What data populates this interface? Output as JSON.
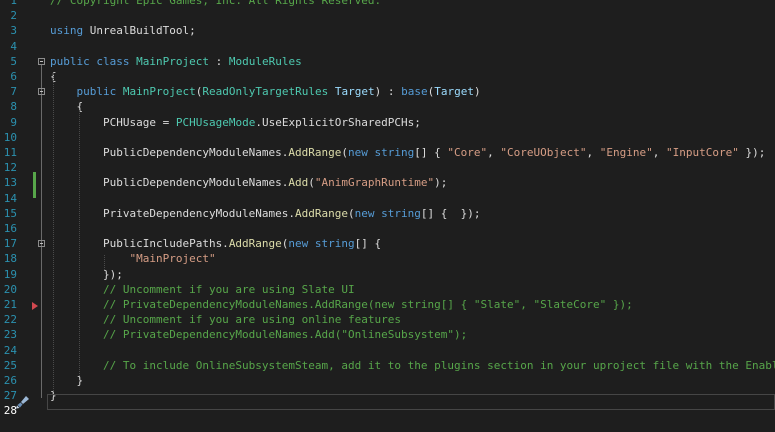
{
  "editor": {
    "language": "C#",
    "current_line": 28,
    "lines": [
      {
        "n": "1",
        "segments": [
          {
            "t": "// Copyright Epic Games, Inc. All Rights Reserved.",
            "c": "comment"
          }
        ]
      },
      {
        "n": "2",
        "segments": []
      },
      {
        "n": "3",
        "segments": [
          {
            "t": "using",
            "c": "keyword"
          },
          {
            "t": " UnrealBuildTool;",
            "c": "plain"
          }
        ]
      },
      {
        "n": "4",
        "segments": []
      },
      {
        "n": "5",
        "segments": [
          {
            "t": "public",
            "c": "keyword"
          },
          {
            "t": " ",
            "c": "plain"
          },
          {
            "t": "class",
            "c": "keyword"
          },
          {
            "t": " ",
            "c": "plain"
          },
          {
            "t": "MainProject",
            "c": "type"
          },
          {
            "t": " : ",
            "c": "plain"
          },
          {
            "t": "ModuleRules",
            "c": "type"
          }
        ]
      },
      {
        "n": "6",
        "segments": [
          {
            "t": "{",
            "c": "plain"
          }
        ]
      },
      {
        "n": "7",
        "segments": [
          {
            "t": "    ",
            "c": "plain"
          },
          {
            "t": "public",
            "c": "keyword"
          },
          {
            "t": " ",
            "c": "plain"
          },
          {
            "t": "MainProject",
            "c": "type"
          },
          {
            "t": "(",
            "c": "plain"
          },
          {
            "t": "ReadOnlyTargetRules",
            "c": "type"
          },
          {
            "t": " ",
            "c": "plain"
          },
          {
            "t": "Target",
            "c": "param"
          },
          {
            "t": ") : ",
            "c": "plain"
          },
          {
            "t": "base",
            "c": "keyword"
          },
          {
            "t": "(",
            "c": "plain"
          },
          {
            "t": "Target",
            "c": "param"
          },
          {
            "t": ")",
            "c": "plain"
          }
        ]
      },
      {
        "n": "8",
        "segments": [
          {
            "t": "    {",
            "c": "plain"
          }
        ]
      },
      {
        "n": "9",
        "segments": [
          {
            "t": "        PCHUsage = ",
            "c": "plain"
          },
          {
            "t": "PCHUsageMode",
            "c": "type"
          },
          {
            "t": ".UseExplicitOrSharedPCHs;",
            "c": "plain"
          }
        ]
      },
      {
        "n": "10",
        "segments": []
      },
      {
        "n": "11",
        "segments": [
          {
            "t": "        PublicDependencyModuleNames.",
            "c": "plain"
          },
          {
            "t": "AddRange",
            "c": "method"
          },
          {
            "t": "(",
            "c": "plain"
          },
          {
            "t": "new",
            "c": "keyword"
          },
          {
            "t": " ",
            "c": "plain"
          },
          {
            "t": "string",
            "c": "keyword"
          },
          {
            "t": "[] { ",
            "c": "plain"
          },
          {
            "t": "\"Core\"",
            "c": "string"
          },
          {
            "t": ", ",
            "c": "plain"
          },
          {
            "t": "\"CoreUObject\"",
            "c": "string"
          },
          {
            "t": ", ",
            "c": "plain"
          },
          {
            "t": "\"Engine\"",
            "c": "string"
          },
          {
            "t": ", ",
            "c": "plain"
          },
          {
            "t": "\"InputCore\"",
            "c": "string"
          },
          {
            "t": " });",
            "c": "plain"
          }
        ]
      },
      {
        "n": "12",
        "segments": []
      },
      {
        "n": "13",
        "segments": [
          {
            "t": "        PublicDependencyModuleNames.",
            "c": "plain"
          },
          {
            "t": "Add",
            "c": "method"
          },
          {
            "t": "(",
            "c": "plain"
          },
          {
            "t": "\"AnimGraphRuntime\"",
            "c": "string"
          },
          {
            "t": ");",
            "c": "plain"
          }
        ]
      },
      {
        "n": "14",
        "segments": []
      },
      {
        "n": "15",
        "segments": [
          {
            "t": "        PrivateDependencyModuleNames.",
            "c": "plain"
          },
          {
            "t": "AddRange",
            "c": "method"
          },
          {
            "t": "(",
            "c": "plain"
          },
          {
            "t": "new",
            "c": "keyword"
          },
          {
            "t": " ",
            "c": "plain"
          },
          {
            "t": "string",
            "c": "keyword"
          },
          {
            "t": "[] {  });",
            "c": "plain"
          }
        ]
      },
      {
        "n": "16",
        "segments": []
      },
      {
        "n": "17",
        "segments": [
          {
            "t": "        PublicIncludePaths.",
            "c": "plain"
          },
          {
            "t": "AddRange",
            "c": "method"
          },
          {
            "t": "(",
            "c": "plain"
          },
          {
            "t": "new",
            "c": "keyword"
          },
          {
            "t": " ",
            "c": "plain"
          },
          {
            "t": "string",
            "c": "keyword"
          },
          {
            "t": "[] {",
            "c": "plain"
          }
        ]
      },
      {
        "n": "18",
        "segments": [
          {
            "t": "            ",
            "c": "plain"
          },
          {
            "t": "\"MainProject\"",
            "c": "string"
          }
        ]
      },
      {
        "n": "19",
        "segments": [
          {
            "t": "        });",
            "c": "plain"
          }
        ]
      },
      {
        "n": "20",
        "segments": [
          {
            "t": "        // Uncomment if you are using Slate UI",
            "c": "comment"
          }
        ]
      },
      {
        "n": "21",
        "segments": [
          {
            "t": "        // PrivateDependencyModuleNames.AddRange(new string[] { \"Slate\", \"SlateCore\" });",
            "c": "comment"
          }
        ]
      },
      {
        "n": "22",
        "segments": [
          {
            "t": "        // Uncomment if you are using online features",
            "c": "comment"
          }
        ]
      },
      {
        "n": "23",
        "segments": [
          {
            "t": "        // PrivateDependencyModuleNames.Add(\"OnlineSubsystem\");",
            "c": "comment"
          }
        ]
      },
      {
        "n": "24",
        "segments": []
      },
      {
        "n": "25",
        "segments": [
          {
            "t": "        // To include OnlineSubsystemSteam, add it to the plugins section in your uproject file with the Enabled a",
            "c": "comment"
          }
        ]
      },
      {
        "n": "26",
        "segments": [
          {
            "t": "    }",
            "c": "plain"
          }
        ]
      },
      {
        "n": "27",
        "segments": [
          {
            "t": "}",
            "c": "plain"
          }
        ]
      },
      {
        "n": "28",
        "segments": []
      }
    ]
  },
  "colors": {
    "background": "#1e1e1e",
    "line_number": "#2b91af",
    "keyword": "#569cd6",
    "type": "#4ec9b0",
    "string": "#d69d85",
    "comment": "#57a64a",
    "change_bar": "#57a64a",
    "breakpoint_arrow": "#d1484f"
  },
  "icons": {
    "fold_toggle": "minus-box-icon",
    "execution_marker": "breakpoint-arrow-icon",
    "quick_actions": "paintbrush-icon"
  }
}
